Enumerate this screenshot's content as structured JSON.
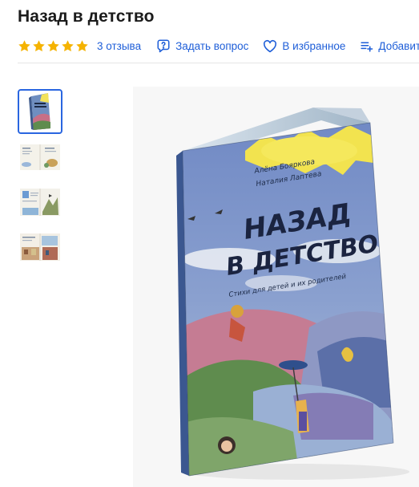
{
  "product": {
    "title": "Назад в детство"
  },
  "rating": {
    "stars": 5,
    "max_stars": 5,
    "star_color": "#f5b301"
  },
  "actions": {
    "reviews_label": "3 отзыва",
    "ask_label": "Задать вопрос",
    "favorite_label": "В избранное",
    "compare_label": "Добавить"
  },
  "accent_color": "#1e5ed8",
  "gallery": {
    "selected_index": 0,
    "thumbnails": [
      "book-cover",
      "spread-1",
      "spread-2",
      "spread-3"
    ]
  },
  "cover": {
    "authors": [
      "Алёна Бояркова",
      "Наталия Лаптева"
    ],
    "title_line1": "НАЗАД",
    "title_line2": "В ДЕТСТВО",
    "subtitle": "Стихи для детей и их родителей"
  }
}
